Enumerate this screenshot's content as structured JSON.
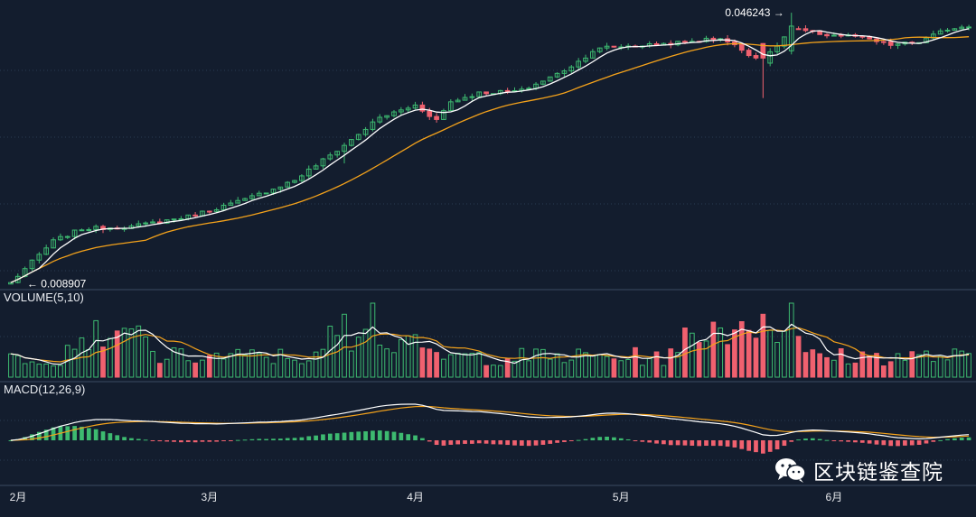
{
  "chart_data": [
    {
      "panel": "price",
      "type": "candlestick",
      "title": "",
      "x_ticks": [
        "2月",
        "3月",
        "4月",
        "5月",
        "6月"
      ],
      "annotations": [
        {
          "text": "← 0.008907",
          "kind": "min",
          "value": 0.008907
        },
        {
          "text": "0.046243 →",
          "kind": "max",
          "value": 0.046243
        }
      ],
      "ylim": [
        0.0085,
        0.047
      ],
      "close_anchor_days": [
        0,
        6,
        10,
        17,
        25,
        33,
        40,
        47,
        52,
        57,
        60,
        62,
        66,
        72,
        77,
        80,
        82,
        84,
        90,
        95,
        100,
        106,
        110,
        115,
        119,
        121,
        124,
        128,
        132,
        135
      ],
      "close_anchor_values": [
        0.0091,
        0.0148,
        0.0165,
        0.0168,
        0.0182,
        0.0205,
        0.0232,
        0.028,
        0.0318,
        0.0335,
        0.0315,
        0.034,
        0.0352,
        0.0355,
        0.0378,
        0.0395,
        0.041,
        0.0415,
        0.0418,
        0.0422,
        0.0428,
        0.0395,
        0.044,
        0.0432,
        0.043,
        0.0425,
        0.0418,
        0.0422,
        0.044,
        0.0445
      ],
      "series_colors": {
        "up": "#3dba70",
        "down": "#f0616f",
        "ma_fast": "#ffffff",
        "ma_slow": "#f4a21b"
      }
    },
    {
      "panel": "volume",
      "type": "bar",
      "label": "VOLUME(5,10)",
      "ma_periods": [
        5,
        10
      ]
    },
    {
      "panel": "macd",
      "type": "bar",
      "label": "MACD(12,26,9)",
      "params": [
        12,
        26,
        9
      ]
    }
  ],
  "watermark": {
    "text": "区块链鉴查院",
    "icon": "wechat-icon"
  },
  "colors": {
    "background": "#131d2e",
    "grid": "#2a3a52",
    "text": "#e6e8ec"
  }
}
